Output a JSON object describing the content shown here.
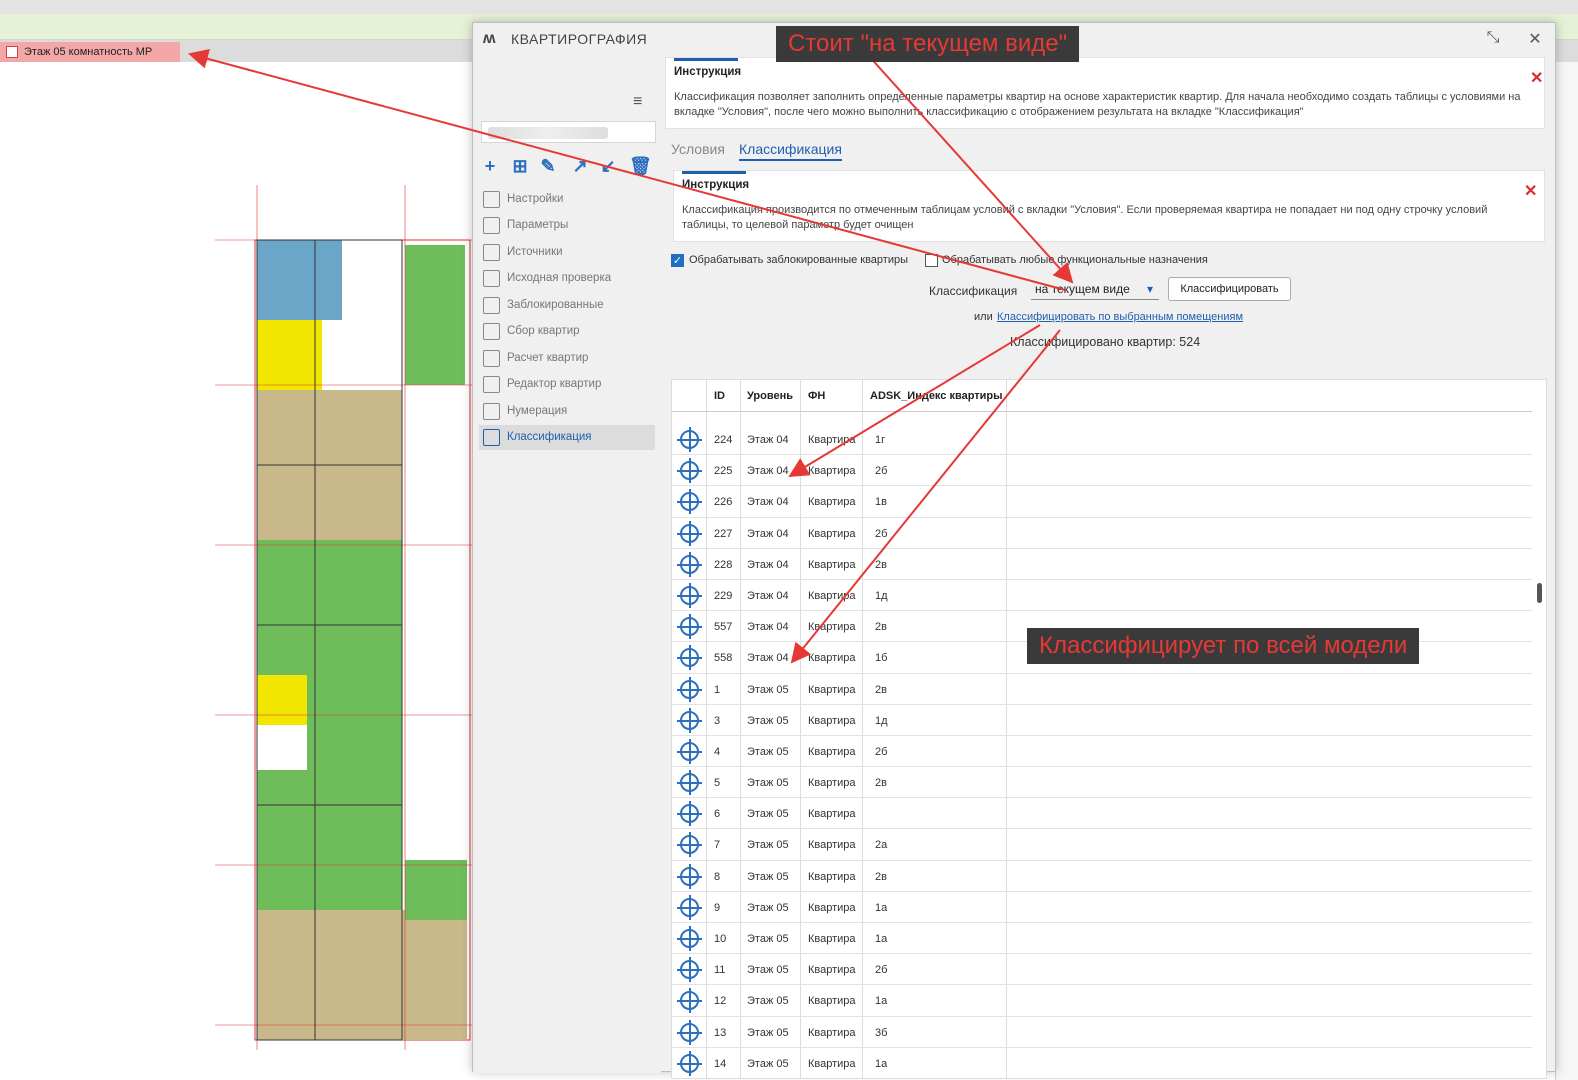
{
  "background": {
    "view_tab": "Этаж 05 комнатность МР"
  },
  "dialog": {
    "title": "КВАРТИРОГРАФИЯ",
    "sidebar": {
      "items": [
        {
          "label": "Настройки",
          "icon": "gear-icon"
        },
        {
          "label": "Параметры",
          "icon": "tag-icon"
        },
        {
          "label": "Источники",
          "icon": "database-icon"
        },
        {
          "label": "Исходная проверка",
          "icon": "check-icon"
        },
        {
          "label": "Заблокированные",
          "icon": "lock-icon"
        },
        {
          "label": "Сбор квартир",
          "icon": "collect-icon"
        },
        {
          "label": "Расчет квартир",
          "icon": "calc-icon"
        },
        {
          "label": "Редактор квартир",
          "icon": "edit-icon"
        },
        {
          "label": "Нумерация",
          "icon": "number-icon"
        },
        {
          "label": "Классификация",
          "icon": "classify-icon"
        }
      ]
    },
    "instruction_top": {
      "title": "Инструкция",
      "body": "Классификация позволяет заполнить определенные параметры квартир на основе характеристик квартир. Для начала необходимо создать таблицы с условиями на вкладке \"Условия\", после чего можно выполнить классификацию с отображением результата на вкладке \"Классификация\""
    },
    "tabs": [
      "Условия",
      "Классификация"
    ],
    "instruction_inner": {
      "title": "Инструкция",
      "body": "Классификация производится по отмеченным таблицам условий с вкладки \"Условия\". Если проверяемая квартира не попадает ни под одну строчку условий таблицы, то целевой параметр будет очищен"
    },
    "checkbox_blocked": "Обрабатывать заблокированные квартиры",
    "checkbox_any": "Обрабатывать любые функциональные назначения",
    "classification_label": "Классификация",
    "classification_value": "на текущем виде",
    "classify_button": "Классифицировать",
    "or_text": "или",
    "classify_selected_link": "Классифицировать по выбранным помещениям",
    "classified_count": "Классифицировано квартир: 524",
    "table": {
      "headers": [
        "ID",
        "Уровень",
        "ФН",
        "ADSK_Индекс квартиры"
      ],
      "rows": [
        [
          "224",
          "Этаж 04",
          "Квартира",
          "1г"
        ],
        [
          "225",
          "Этаж 04",
          "Квартира",
          "2б"
        ],
        [
          "226",
          "Этаж 04",
          "Квартира",
          "1в"
        ],
        [
          "227",
          "Этаж 04",
          "Квартира",
          "2б"
        ],
        [
          "228",
          "Этаж 04",
          "Квартира",
          "2в"
        ],
        [
          "229",
          "Этаж 04",
          "Квартира",
          "1д"
        ],
        [
          "557",
          "Этаж 04",
          "Квартира",
          "2в"
        ],
        [
          "558",
          "Этаж 04",
          "Квартира",
          "1б"
        ],
        [
          "1",
          "Этаж 05",
          "Квартира",
          "2в"
        ],
        [
          "3",
          "Этаж 05",
          "Квартира",
          "1д"
        ],
        [
          "4",
          "Этаж 05",
          "Квартира",
          "2б"
        ],
        [
          "5",
          "Этаж 05",
          "Квартира",
          "2в"
        ],
        [
          "6",
          "Этаж 05",
          "Квартира",
          ""
        ],
        [
          "7",
          "Этаж 05",
          "Квартира",
          "2а"
        ],
        [
          "8",
          "Этаж 05",
          "Квартира",
          "2в"
        ],
        [
          "9",
          "Этаж 05",
          "Квартира",
          "1а"
        ],
        [
          "10",
          "Этаж 05",
          "Квартира",
          "1а"
        ],
        [
          "11",
          "Этаж 05",
          "Квартира",
          "2б"
        ],
        [
          "12",
          "Этаж 05",
          "Квартира",
          "1а"
        ],
        [
          "13",
          "Этаж 05",
          "Квартира",
          "3б"
        ],
        [
          "14",
          "Этаж 05",
          "Квартира",
          "1а"
        ]
      ]
    }
  },
  "annotations": {
    "top": "Стоит \"на текущем виде\"",
    "middle": "Классифицирует по всей модели"
  },
  "colors": {
    "accent": "#1f5fb0",
    "annotation_text": "#e53935",
    "arrow": "#e53935"
  }
}
